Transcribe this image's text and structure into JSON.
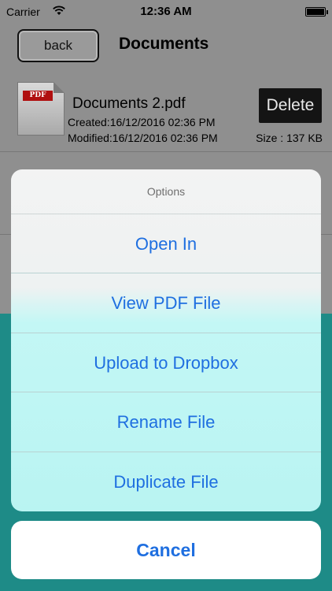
{
  "status_bar": {
    "carrier": "Carrier",
    "time": "12:36 AM"
  },
  "nav": {
    "back_label": "back",
    "title": "Documents"
  },
  "files": [
    {
      "icon_tag": "PDF",
      "name": "Documents 2.pdf",
      "created": "Created:16/12/2016 02:36 PM",
      "modified": "Modified:16/12/2016 02:36 PM",
      "size": "Size : 137 KB",
      "delete_label": "Delete"
    }
  ],
  "action_sheet": {
    "title": "Options",
    "items": [
      "Open In",
      "View PDF File",
      "Upload to Dropbox",
      "Rename File",
      "Duplicate File"
    ],
    "cancel_label": "Cancel"
  },
  "colors": {
    "accent": "#1f6fe0",
    "overlay_gray": "#8f8f8f",
    "teal": "#1e8b87"
  }
}
